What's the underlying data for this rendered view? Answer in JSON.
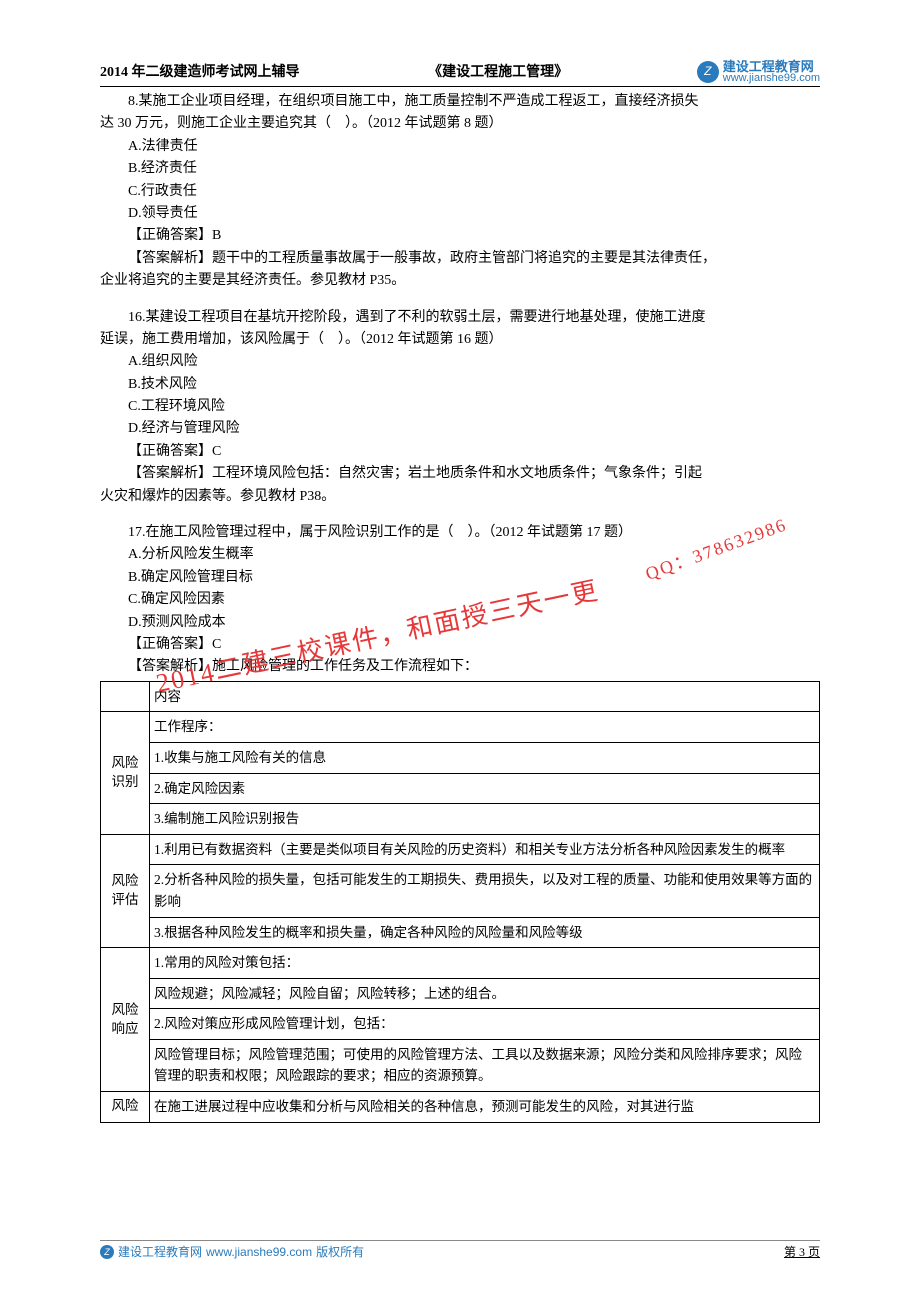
{
  "header": {
    "left": "2014 年二级建造师考试网上辅导",
    "mid": "《建设工程施工管理》",
    "logo_cn": "建设工程教育网",
    "logo_url": "www.jianshe99.com"
  },
  "q8": {
    "stem": "8.某施工企业项目经理，在组织项目施工中，施工质量控制不严造成工程返工，直接经济损失",
    "stem2": "达 30 万元，则施工企业主要追究其（　）。（2012 年试题第 8 题）",
    "A": "A.法律责任",
    "B": "B.经济责任",
    "C": "C.行政责任",
    "D": "D.领导责任",
    "ans": "【正确答案】B",
    "exp1": "【答案解析】题干中的工程质量事故属于一般事故，政府主管部门将追究的主要是其法律责任，",
    "exp2": "企业将追究的主要是其经济责任。参见教材 P35。"
  },
  "q16": {
    "stem": "16.某建设工程项目在基坑开挖阶段，遇到了不利的软弱土层，需要进行地基处理，使施工进度",
    "stem2": "延误，施工费用增加，该风险属于（　）。（2012 年试题第 16 题）",
    "A": "A.组织风险",
    "B": "B.技术风险",
    "C": "C.工程环境风险",
    "D": "D.经济与管理风险",
    "ans": "【正确答案】C",
    "exp1": "【答案解析】工程环境风险包括：自然灾害；岩土地质条件和水文地质条件；气象条件；引起",
    "exp2": "火灾和爆炸的因素等。参见教材 P38。"
  },
  "q17": {
    "stem": "17.在施工风险管理过程中，属于风险识别工作的是（　）。（2012 年试题第 17 题）",
    "A": "A.分析风险发生概率",
    "B": "B.确定风险管理目标",
    "C": "C.确定风险因素",
    "D": "D.预测风险成本",
    "ans": "【正确答案】C",
    "exp": "【答案解析】施工风险管理的工作任务及工作流程如下："
  },
  "table": {
    "h_content": "内容",
    "r1_label": "风险识别",
    "r1_1": "工作程序：",
    "r1_2": "1.收集与施工风险有关的信息",
    "r1_3": "2.确定风险因素",
    "r1_4": "3.编制施工风险识别报告",
    "r2_label": "风险评估",
    "r2_1": "1.利用已有数据资料（主要是类似项目有关风险的历史资料）和相关专业方法分析各种风险因素发生的概率",
    "r2_2": "2.分析各种风险的损失量，包括可能发生的工期损失、费用损失，以及对工程的质量、功能和使用效果等方面的影响",
    "r2_3": "3.根据各种风险发生的概率和损失量，确定各种风险的风险量和风险等级",
    "r3_label": "风险响应",
    "r3_1": "1.常用的风险对策包括：",
    "r3_2": "风险规避；风险减轻；风险自留；风险转移；上述的组合。",
    "r3_3": "2.风险对策应形成风险管理计划，包括：",
    "r3_4": "风险管理目标；风险管理范围；可使用的风险管理方法、工具以及数据来源；风险分类和风险排序要求；风险管理的职责和权限；风险跟踪的要求；相应的资源预算。",
    "r4_label": "风险",
    "r4_1": "在施工进展过程中应收集和分析与风险相关的各种信息，预测可能发生的风险，对其进行监"
  },
  "watermark": {
    "main": "2014二建三校课件，和面授三天一更",
    "qq": "QQ：378632986"
  },
  "footer": {
    "site": "建设工程教育网",
    "url": "www.jianshe99.com",
    "copyright": "版权所有",
    "page": "第 3 页"
  }
}
